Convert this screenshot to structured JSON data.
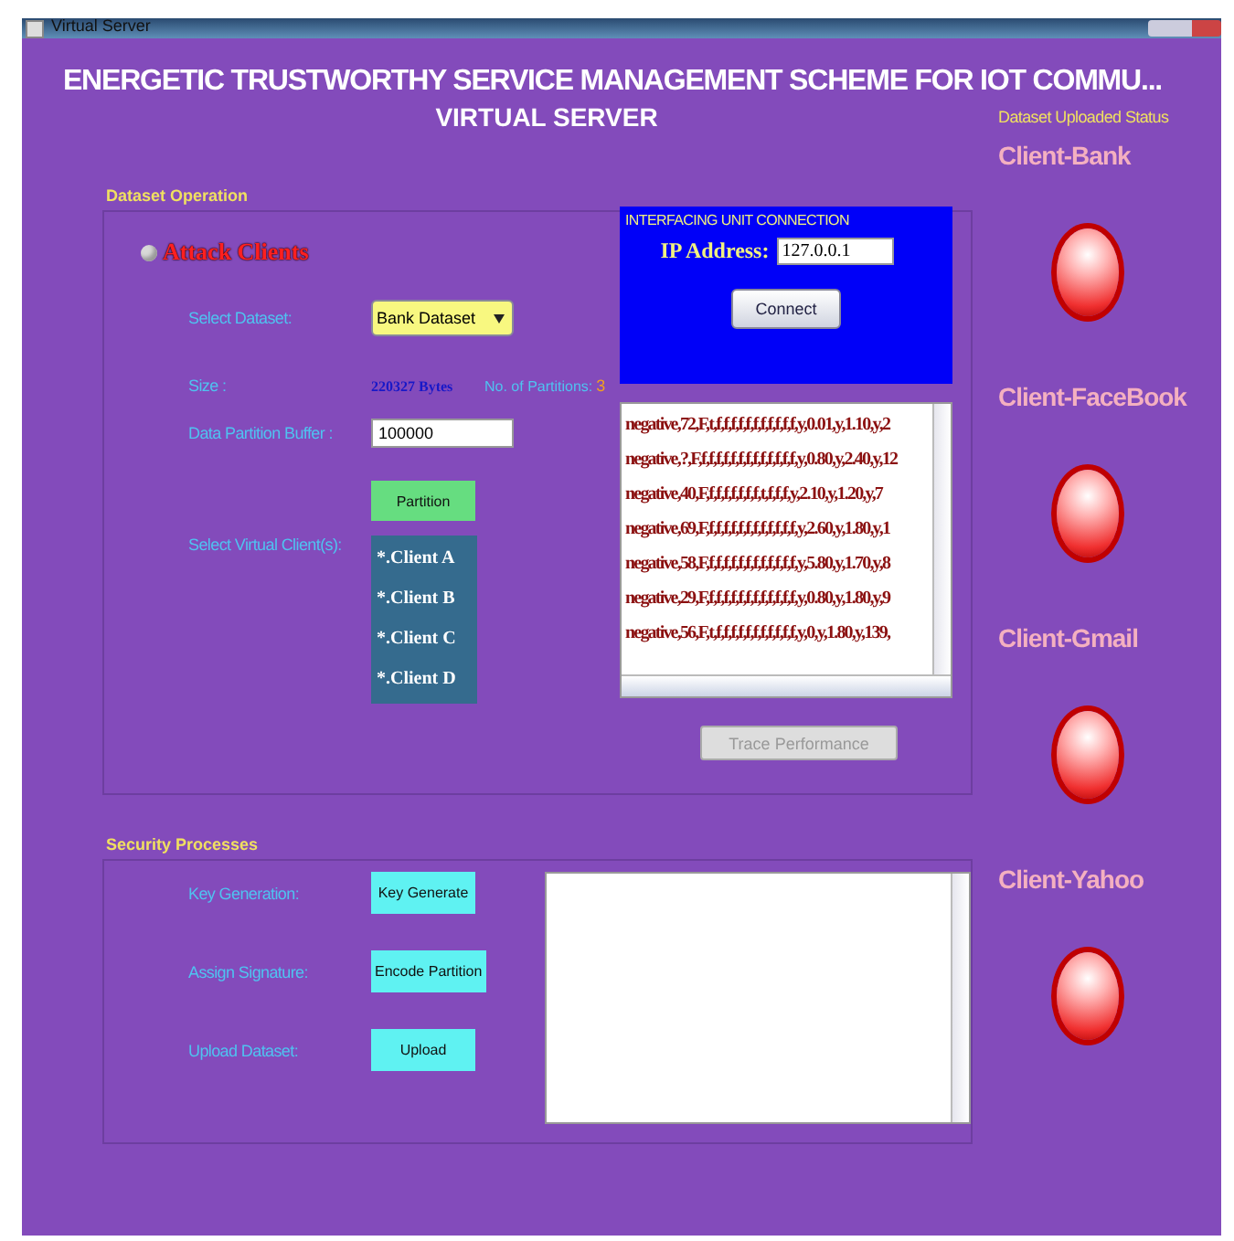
{
  "window": {
    "title": "Virtual Server"
  },
  "header": {
    "title": "ENERGETIC TRUSTWORTHY SERVICE MANAGEMENT SCHEME FOR IOT COMMU...",
    "subtitle": "VIRTUAL SERVER"
  },
  "dataset_operation": {
    "legend": "Dataset Operation",
    "attack_clients": {
      "label": "Attack Clients",
      "selected": false
    },
    "select_dataset": {
      "label": "Select Dataset:",
      "value": "Bank Dataset"
    },
    "size": {
      "label": "Size :",
      "value": "220327 Bytes",
      "partitions_label": "No. of Partitions:",
      "partitions_value": "3"
    },
    "buffer": {
      "label": "Data Partition Buffer :",
      "value": "100000"
    },
    "partition_button": "Partition",
    "virtual_clients": {
      "label": "Select Virtual Client(s):",
      "items": [
        "*.Client A",
        "*.Client B",
        "*.Client C",
        "*.Client D"
      ]
    },
    "connection": {
      "legend": "INTERFACING UNIT CONNECTION",
      "ip_label": "IP Address:",
      "ip_value": "127.0.0.1",
      "button": "Connect"
    },
    "log_lines": [
      "negative,72,F,t,f,f,f,f,f,f,f,f,f,f,f,y,0.01,y,1.10,y,2",
      "negative,?,F,f,f,f,f,f,f,f,f,f,f,f,f,f,y,0.80,y,2.40,y,12",
      "negative,40,F,f,f,f,f,f,f,f,t,f,f,f,y,2.10,y,1.20,y,7",
      "negative,69,F,f,f,f,f,f,f,f,f,f,f,f,f,y,2.60,y,1.80,y,1",
      "negative,58,F,f,f,f,f,f,f,f,f,f,f,f,f,y,5.80,y,1.70,y,8",
      "negative,29,F,f,f,f,f,f,f,f,f,f,f,f,f,y,0.80,y,1.80,y,9",
      "negative,56,F,t,f,f,f,f,f,f,f,f,f,f,f,y,0,y,1.80,y,139,"
    ],
    "trace_button": {
      "label": "Trace Performance",
      "disabled": true
    }
  },
  "security_processes": {
    "legend": "Security Processes",
    "rows": [
      {
        "label": "Key Generation:",
        "button": "Key Generate"
      },
      {
        "label": "Assign Signature:",
        "button": "Encode Partition"
      },
      {
        "label": "Upload Dataset:",
        "button": "Upload"
      }
    ]
  },
  "status": {
    "title": "Dataset Uploaded Status",
    "clients": [
      {
        "name": "Client-Bank"
      },
      {
        "name": "Client-FaceBook"
      },
      {
        "name": "Client-Gmail"
      },
      {
        "name": "Client-Yahoo"
      }
    ]
  }
}
